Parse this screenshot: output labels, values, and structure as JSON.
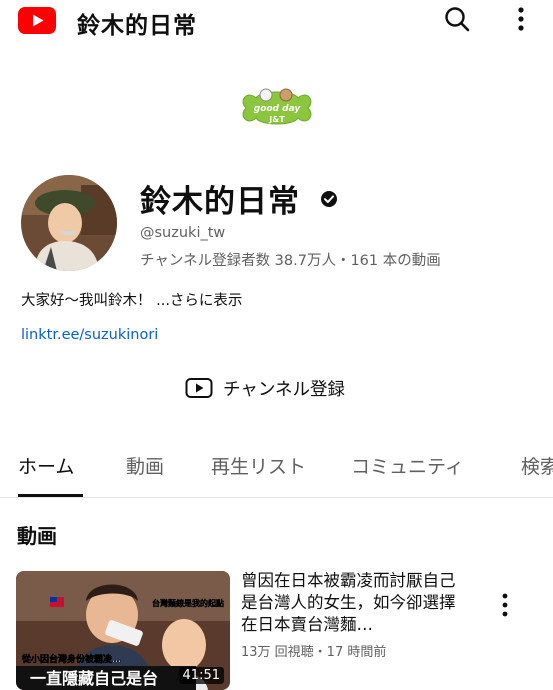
{
  "app": {
    "brand_color": "#ff0000"
  },
  "topbar": {
    "title": "鈴木的日常",
    "icons": [
      "youtube-logo",
      "search-icon",
      "more-vert-icon"
    ]
  },
  "channel": {
    "logo_text_top": "good day",
    "logo_text_bottom": "J&T",
    "name": "鈴木的日常",
    "handle": "@suzuki_tw",
    "stats": "チャンネル登録者数 38.7万人・161 本の動画",
    "description": "大家好〜我叫鈴木！",
    "more_label": "...さらに表示",
    "link": "linktr.ee/suzukinori",
    "subscribe_label": "チャンネル登録"
  },
  "tabs": [
    {
      "label": "ホーム",
      "active": true
    },
    {
      "label": "動画",
      "active": false
    },
    {
      "label": "再生リスト",
      "active": false
    },
    {
      "label": "コミュニティ",
      "active": false
    },
    {
      "label": "検索",
      "active": false
    }
  ],
  "section": {
    "title": "動画"
  },
  "video": {
    "title": "曾因在日本被霸凌而討厭自己是台灣人的女生，如今卻選擇在日本賣台灣麵…",
    "meta": "13万 回視聴・17 時間前",
    "duration": "41:51",
    "thumb_caption_top": "台灣麵線是我的起點",
    "thumb_caption_mid": "從小因台灣身份被霸凌…",
    "thumb_caption_big": "一直隱藏自己是台"
  }
}
